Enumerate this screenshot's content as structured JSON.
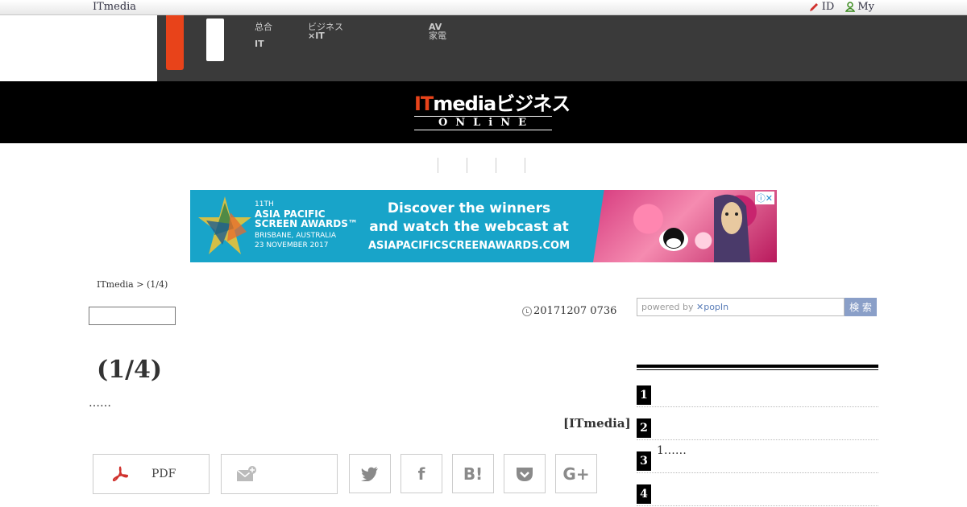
{
  "topbar": {
    "brand": "ITmedia",
    "id_label": "ID",
    "my_label": "My"
  },
  "nav": {
    "items": [
      {
        "line1": "总合",
        "line2": "IT"
      },
      {
        "line1": "ビジネス",
        "line2": "×IT"
      },
      {
        "line1": "AV",
        "line2": "家電"
      }
    ]
  },
  "header": {
    "logo_main": "ビジネス",
    "logo_it": "IT",
    "logo_media": "media",
    "logo_sub": "ONLiNE"
  },
  "banner": {
    "awards_line1": "11TH",
    "awards_line2": "ASIA PACIFIC",
    "awards_line3": "SCREEN AWARDS™",
    "awards_line4": "BRISBANE, AUSTRALIA",
    "awards_line5": "23 NOVEMBER 2017",
    "headline1": "Discover the winners",
    "headline2": "and watch the webcast at",
    "url": "ASIAPACIFICSCREENAWARDS.COM"
  },
  "breadcrumb": "ITmedia  >  (1/4)",
  "article": {
    "date": "20171207 0736",
    "title": "(1/4)",
    "lede": "……",
    "byline": "[ITmedia]"
  },
  "share": {
    "pdf_label": "PDF"
  },
  "sidebar": {
    "popin_text_prefix": "powered by ",
    "popin_brand": "✕popIn",
    "search_button": "検 索",
    "ranking": [
      {
        "num": "1",
        "text": ""
      },
      {
        "num": "2",
        "text": ""
      },
      {
        "num": "3",
        "text": "1……"
      },
      {
        "num": "4",
        "text": ""
      }
    ]
  },
  "colors": {
    "accent": "#e8431a",
    "nav_bg": "#3a3a3a",
    "banner_bg": "#18a4c9"
  }
}
